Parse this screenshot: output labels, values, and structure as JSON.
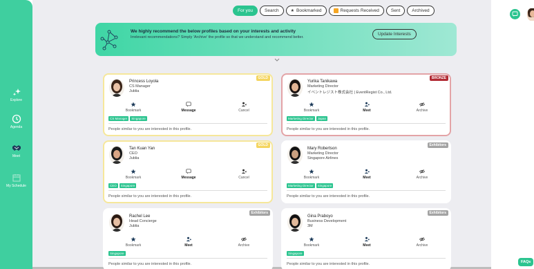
{
  "sidebar": {
    "items": [
      {
        "label": "Explore",
        "icon": "sparkles-icon"
      },
      {
        "label": "Agenda",
        "icon": "clock-icon"
      },
      {
        "label": "Meet",
        "icon": "handshake-icon"
      },
      {
        "label": "My Schedule",
        "icon": "calendar-icon"
      }
    ],
    "active_index": 2
  },
  "filters": {
    "for_you": "For you",
    "search": "Search",
    "bookmarked": "Bookmarked",
    "requests": "Requests Received",
    "sent": "Sent",
    "archived": "Archived"
  },
  "banner": {
    "title": "We highly recommend the below profiles based on your interests and activity",
    "subtitle": "Irrelevant recommendations? Simply 'Archive' the profile so that we understand and recommend better.",
    "button": "Update Interests"
  },
  "common": {
    "bookmark": "Bookmark",
    "message": "Message",
    "cancel": "Cancel",
    "meet": "Meet",
    "archive": "Archive",
    "similar_text": "People similar to you are interested in this profile."
  },
  "cards": [
    {
      "tier": "GOLD",
      "name": "Princess Loyola",
      "title": "CS Manager",
      "company": "Jublia",
      "tags": [
        "CS Manager",
        "Singapore"
      ],
      "actions": [
        "Bookmark",
        "Message",
        "Cancel"
      ]
    },
    {
      "tier": "BRONZE",
      "name": "Yurika Tanikawa",
      "title": "Marketing Director",
      "company": "イベントレジスト株式会社 | EventRegist Co., Ltd.",
      "tags": [
        "Marketing Director",
        "Japan"
      ],
      "actions": [
        "Bookmark",
        "Meet",
        "Archive"
      ]
    },
    {
      "tier": "GOLD",
      "name": "Tan Kuan Yan",
      "title": "CEO",
      "company": "Jublia",
      "tags": [
        "CEO",
        "Singapore"
      ],
      "actions": [
        "Bookmark",
        "Message",
        "Cancel"
      ]
    },
    {
      "tier": "Exhibitors",
      "name": "Mary Robertson",
      "title": "Marketing Director",
      "company": "Singapore Airlines",
      "tags": [
        "Marketing Director",
        "Singapore"
      ],
      "actions": [
        "Bookmark",
        "Meet",
        "Archive"
      ]
    },
    {
      "tier": "Exhibitors",
      "name": "Rachel Lee",
      "title": "Head Concierge",
      "company": "Jublia",
      "tags": [
        "Singapore"
      ],
      "actions": [
        "Bookmark",
        "Meet",
        "Archive"
      ]
    },
    {
      "tier": "Exhibitors",
      "name": "Gina Praboyo",
      "title": "Business Development",
      "company": "3M",
      "tags": [
        "Singapore"
      ],
      "actions": [
        "Bookmark",
        "Meet",
        "Archive"
      ]
    }
  ],
  "faqs": "FAQs",
  "colors": {
    "accent": "#2bc48f",
    "sidebar": "#3fcf9f",
    "gold": "#f6e79a",
    "bronze": "#b22b34"
  }
}
